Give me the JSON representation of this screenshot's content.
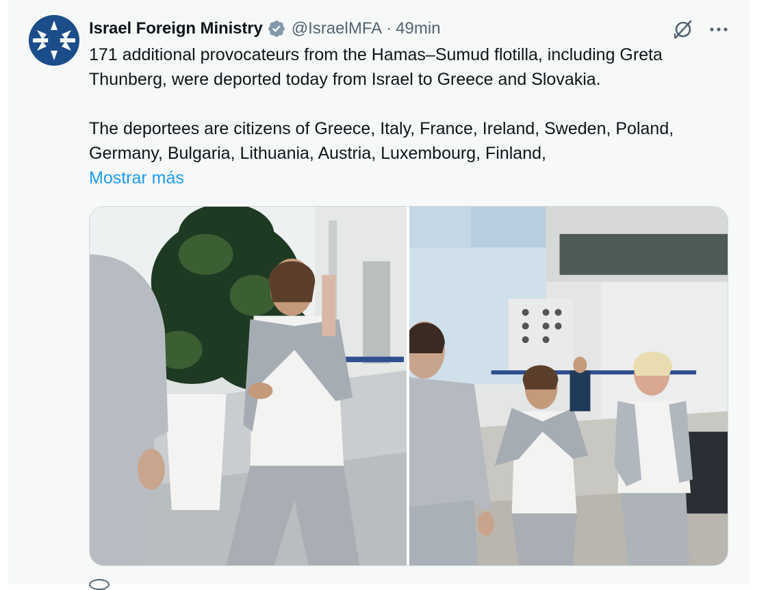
{
  "tweet": {
    "author": {
      "display_name": "Israel Foreign Ministry",
      "handle": "@IsraelMFA",
      "verified": true,
      "avatar_icon": "mfa-star-emblem-icon"
    },
    "separator": "·",
    "timestamp": "49min",
    "text": {
      "paragraph_1": "171 additional provocateurs from the Hamas–Sumud flotilla, including Greta Thunberg, were deported today from Israel to Greece and Slovakia.",
      "paragraph_2": "The deportees are citizens of Greece, Italy, France, Ireland, Sweden, Poland, Germany, Bulgaria, Lithuania, Austria, Luxembourg, Finland,",
      "show_more": "Mostrar más"
    },
    "actions": {
      "grok_icon": "grok-icon",
      "more_icon": "more-options-icon"
    },
    "media": {
      "photo_count": 2,
      "photos": [
        {
          "alt": "People in grey tracksuits walking through an airport terminal"
        },
        {
          "alt": "Three women in grey tracksuits walking through an airport terminal"
        }
      ]
    }
  },
  "colors": {
    "accent": "#1d9bf0",
    "text_primary": "#0f1419",
    "text_secondary": "#536471",
    "background": "#f7f9f9"
  }
}
